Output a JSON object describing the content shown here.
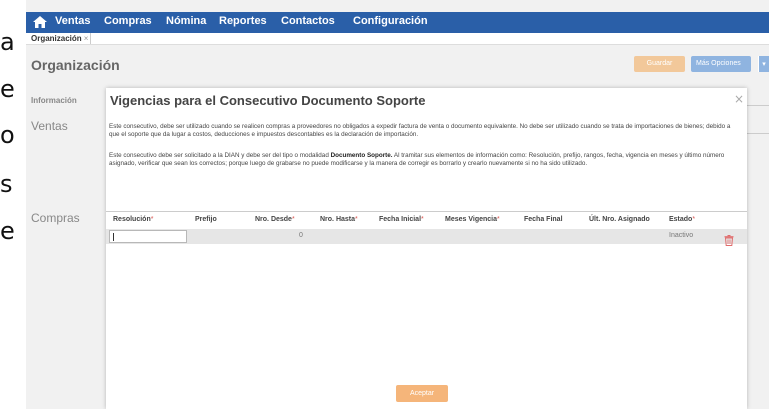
{
  "outer_text": {
    "chars": [
      "a",
      "e",
      "o",
      "s",
      "e"
    ]
  },
  "nav": {
    "home_icon": "home-icon",
    "items": [
      "Ventas",
      "Compras",
      "Nómina",
      "Reportes",
      "Contactos",
      "Configuración"
    ]
  },
  "tabs": [
    {
      "label": "Organización",
      "close": "×"
    }
  ],
  "page": {
    "title": "Organización",
    "save_label": "Guardar",
    "more_label": "Más Opciones",
    "more_caret": "▾"
  },
  "side": {
    "informacion": "Información",
    "ventas": "Ventas",
    "compras": "Compras"
  },
  "modal": {
    "title": "Vigencias para el Consecutivo Documento Soporte",
    "close": "×",
    "para1": "Este consecutivo, debe ser utilizado cuando se realicen compras a proveedores no obligados a expedir factura de venta o documento equivalente. No debe ser utilizado cuando se trata de importaciones de bienes; debido a que el soporte que da lugar a costos, deducciones e impuestos descontables es la declaración de importación.",
    "para2_before": "Este consecutivo debe ser solicitado a la DIAN y debe ser del tipo o modalidad ",
    "para2_bold": "Documento Soporte.",
    "para2_after": " Al tramitar sus elementos de información como: Resolución, prefijo, rangos, fecha, vigencia en meses y último número asignado, verificar que sean los correctos; porque luego de grabarse no puede modificarse y la manera de corregir es borrarlo y crearlo nuevamente si no ha sido utilizado.",
    "columns": [
      {
        "label": "Resolución",
        "required": true
      },
      {
        "label": "Prefijo",
        "required": false
      },
      {
        "label": "Nro. Desde",
        "required": true
      },
      {
        "label": "Nro. Hasta",
        "required": true
      },
      {
        "label": "Fecha Inicial",
        "required": true
      },
      {
        "label": "Meses Vigencia",
        "required": true
      },
      {
        "label": "Fecha Final",
        "required": false
      },
      {
        "label": "Últ. Nro. Asignado",
        "required": false
      },
      {
        "label": "Estado",
        "required": true
      }
    ],
    "required_mark": "*",
    "row": {
      "resolucion": "",
      "nro_desde": "0",
      "estado": "Inactivo",
      "delete_icon": "trash-icon"
    },
    "accept_label": "Aceptar"
  },
  "colors": {
    "nav_bg": "#2a5fa8",
    "save_btn": "#f2c89a",
    "more_btn": "#8fb4e0",
    "accept_btn": "#f5b57a",
    "required": "#d9534f",
    "trash": "#e06b6b"
  }
}
